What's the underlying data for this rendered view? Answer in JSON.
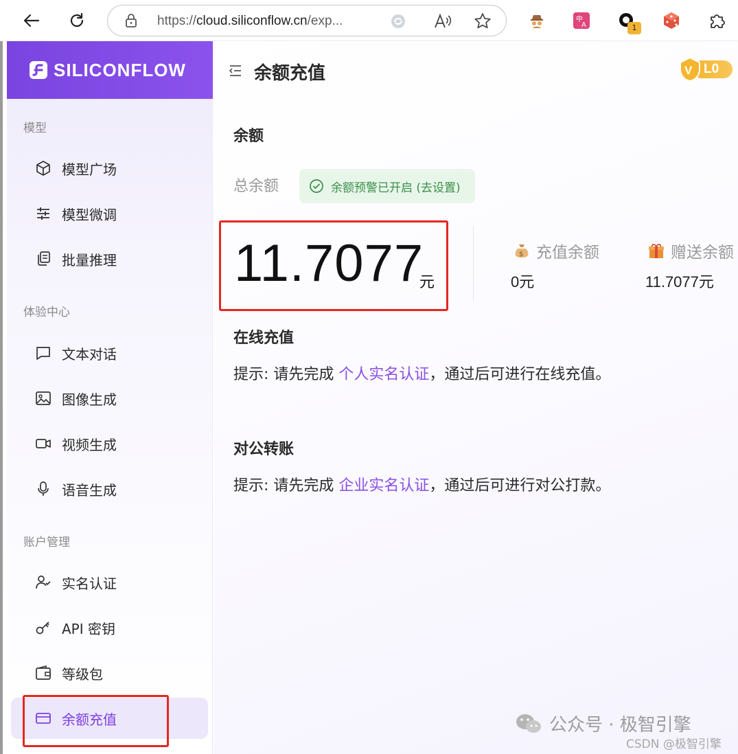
{
  "browser": {
    "url_prefix": "https://",
    "url_host": "cloud.siliconflow.cn",
    "url_rest": "/exp...",
    "extension_badge_count": "1"
  },
  "sidebar": {
    "brand": "SILICONFLOW",
    "sections": [
      {
        "title": "模型",
        "items": [
          {
            "label": "模型广场",
            "icon": "cube-icon"
          },
          {
            "label": "模型微调",
            "icon": "sliders-icon"
          },
          {
            "label": "批量推理",
            "icon": "copy-stack-icon"
          }
        ]
      },
      {
        "title": "体验中心",
        "items": [
          {
            "label": "文本对话",
            "icon": "chat-icon"
          },
          {
            "label": "图像生成",
            "icon": "image-icon"
          },
          {
            "label": "视频生成",
            "icon": "video-icon"
          },
          {
            "label": "语音生成",
            "icon": "mic-icon"
          }
        ]
      },
      {
        "title": "账户管理",
        "items": [
          {
            "label": "实名认证",
            "icon": "user-check-icon"
          },
          {
            "label": "API 密钥",
            "icon": "key-icon"
          },
          {
            "label": "等级包",
            "icon": "wallet-icon"
          },
          {
            "label": "余额充值",
            "icon": "credit-card-icon",
            "active": true
          }
        ]
      }
    ]
  },
  "header": {
    "title": "余额充值",
    "level": "L0"
  },
  "balance": {
    "section_title": "余额",
    "total_label": "总余额",
    "alert_text": "余额预警已开启 (去设置)",
    "amount": "11.7077",
    "unit": "元",
    "recharge_label": "充值余额",
    "recharge_value": "0元",
    "gift_label": "赠送余额",
    "gift_value": "11.7077元"
  },
  "online": {
    "title": "在线充值",
    "hint_prefix": "提示: 请先完成 ",
    "hint_link": "个人实名认证",
    "hint_suffix": "，通过后可进行在线充值。"
  },
  "corporate": {
    "title": "对公转账",
    "hint_prefix": "提示: 请先完成 ",
    "hint_link": "企业实名认证",
    "hint_suffix": "，通过后可进行对公打款。"
  },
  "watermark": {
    "text": "公众号 · 极智引擎",
    "csdn": "CSDN @极智引擎"
  },
  "colors": {
    "brand_purple": "#7a44e0",
    "link_purple": "#8a4fe6",
    "alert_green": "#3c8f4a",
    "annotation_red": "#e4261f",
    "level_gold": "#f3b42d"
  }
}
